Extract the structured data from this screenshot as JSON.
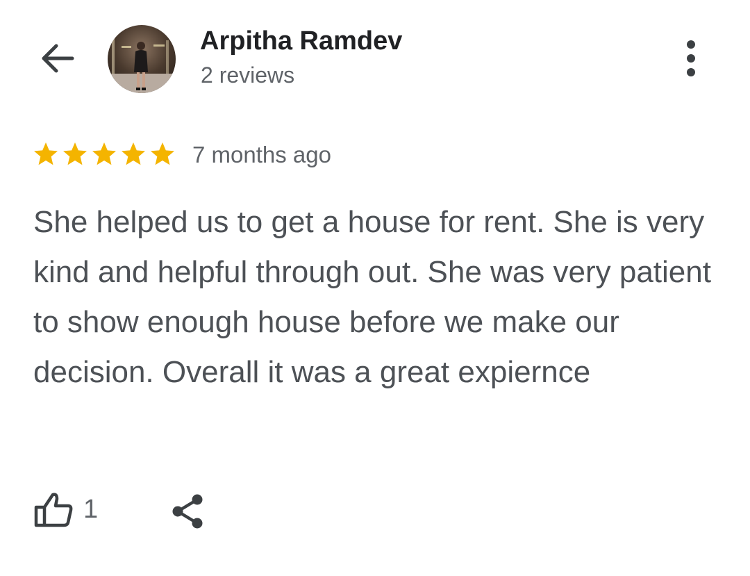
{
  "header": {
    "back_icon": "arrow-left-icon",
    "avatar_description": "profile photo",
    "reviewer_name": "Arpitha Ramdev",
    "review_count": "2 reviews",
    "menu_icon": "more-vertical-icon"
  },
  "review": {
    "rating": 5,
    "rating_max": 5,
    "star_color": "#f4b400",
    "time_ago": "7 months ago",
    "text": "She helped us to get a house for rent. She is very kind and helpful through out. She was very patient to show enough house before we make our decision. Overall it was a great expiernce"
  },
  "actions": {
    "like_icon": "thumbs-up-icon",
    "like_count": "1",
    "share_icon": "share-icon"
  },
  "colors": {
    "primary_text": "#202124",
    "secondary_text": "#5f6368",
    "body_text": "#4d5156",
    "icon": "#3c4043"
  }
}
